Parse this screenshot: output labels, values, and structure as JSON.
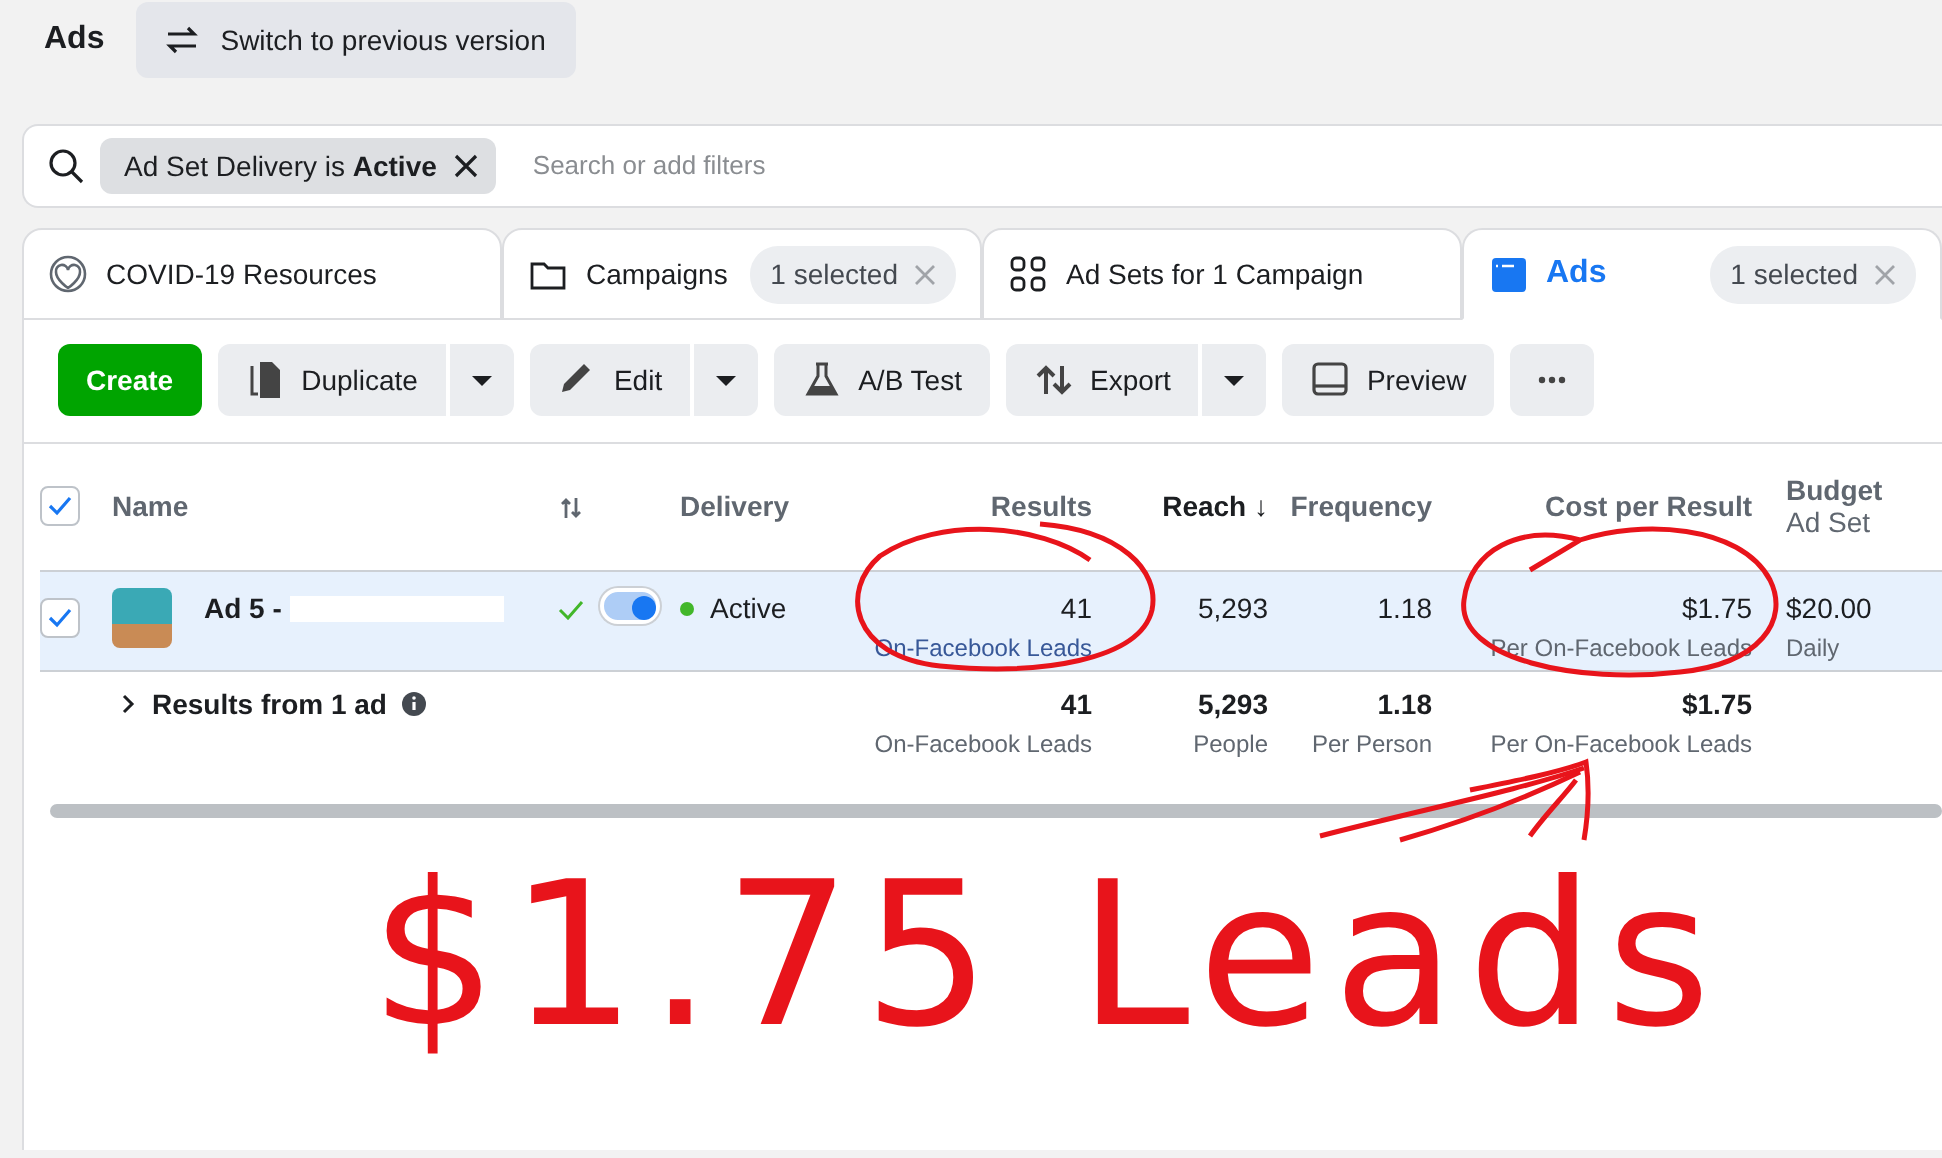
{
  "header": {
    "title": "Ads",
    "switch_button": "Switch to previous version"
  },
  "filter_bar": {
    "chip": "Ad Set Delivery is **Active**",
    "placeholder": "Search or add filters"
  },
  "tabs": [
    {
      "label": "COVID-19 Resources",
      "selected": false
    },
    {
      "label": "Campaigns",
      "badge": "1 selected",
      "selected": false
    },
    {
      "label": "Ad Sets for 1 Campaign",
      "selected": false
    },
    {
      "label": "Ads",
      "badge": "1 selected",
      "selected": true
    }
  ],
  "toolbar": [
    {
      "kind": "primary",
      "label": "Create"
    },
    {
      "kind": "split",
      "label": "Duplicate"
    },
    {
      "kind": "split",
      "label": "Edit"
    },
    {
      "kind": "plain",
      "label": "A/B Test"
    },
    {
      "kind": "split",
      "label": "Export"
    },
    {
      "kind": "plain",
      "label": "Preview"
    },
    {
      "kind": "more"
    }
  ],
  "table": {
    "select_all_checked": true,
    "columns": [
      {
        "label": "Name"
      },
      {
        "label": "Delivery"
      },
      {
        "label": "Results"
      },
      {
        "label": "Reach ↓",
        "sorted": true
      },
      {
        "label": "Frequency"
      },
      {
        "label": "Cost per Result"
      },
      {
        "label": "Budget",
        "sub": "Ad Set"
      }
    ],
    "rows": [
      {
        "selected": true,
        "checked": true,
        "name": "Ad 5 -",
        "on": true,
        "delivery": "Active",
        "results": "41",
        "results_sub": "On-Facebook Leads",
        "reach": "5,293",
        "frequency": "1.18",
        "cost": "$1.75",
        "cost_sub": "Per On-Facebook Leads",
        "budget": "$20.00",
        "budget_sub": "Daily"
      }
    ],
    "summary": {
      "label": "Results from 1 ad",
      "results": "41",
      "results_sub": "On-Facebook Leads",
      "reach": "5,293",
      "reach_sub": "People",
      "frequency": "1.18",
      "frequency_sub": "Per Person",
      "cost": "$1.75",
      "cost_sub": "Per On-Facebook Leads"
    }
  },
  "annotation": {
    "text": "$1.75 Leads"
  }
}
